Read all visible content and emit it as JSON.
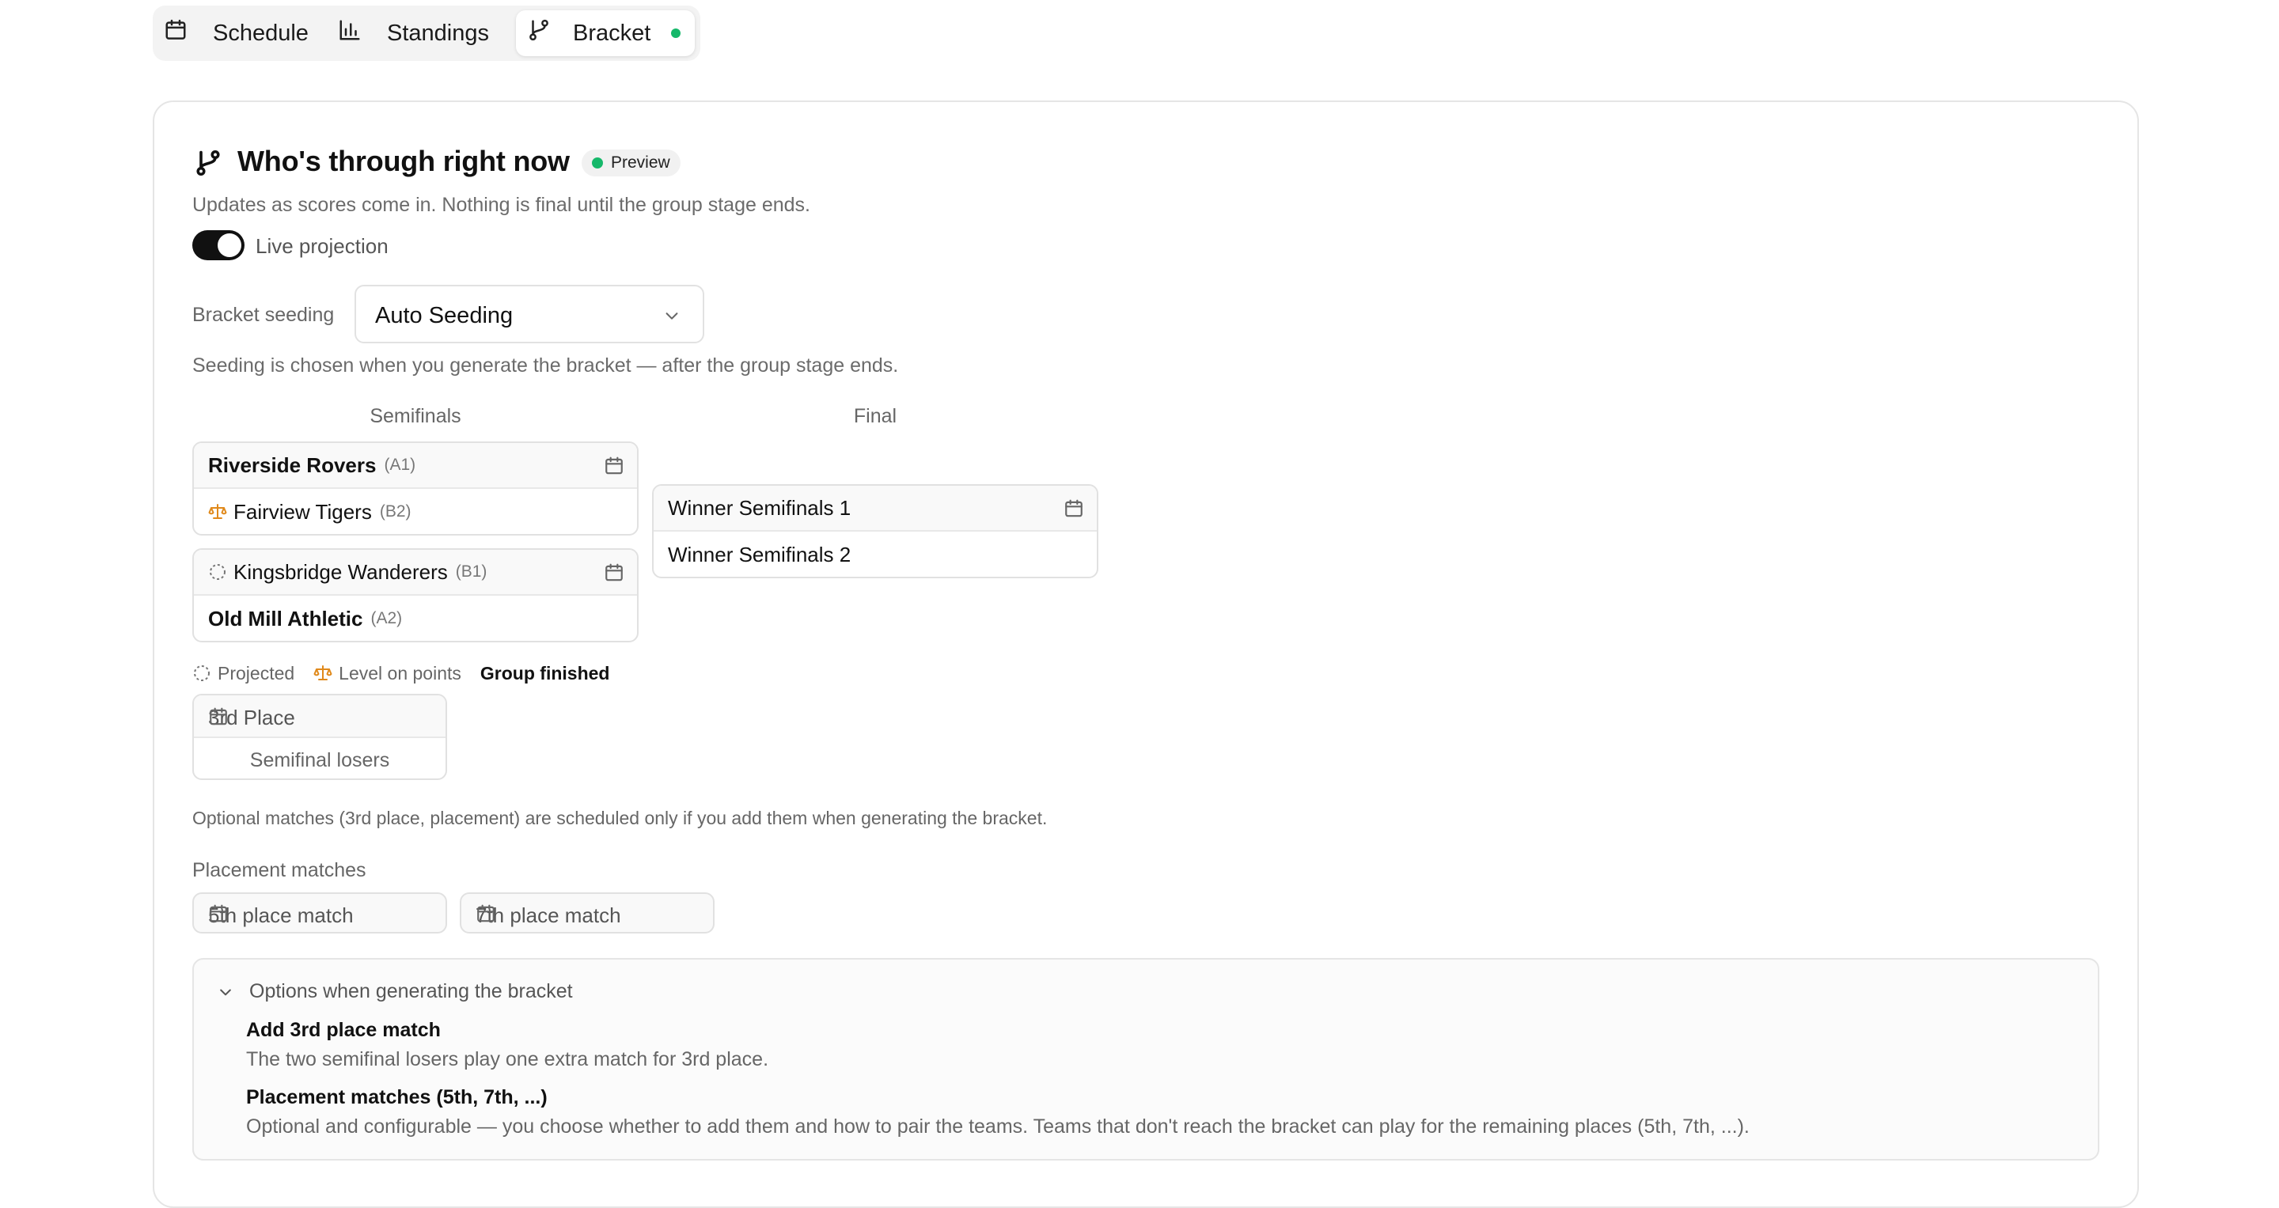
{
  "tabs": [
    {
      "label": "Schedule",
      "icon": "calendar-icon",
      "active": false
    },
    {
      "label": "Standings",
      "icon": "bar-chart-icon",
      "active": false
    },
    {
      "label": "Bracket",
      "icon": "git-branch-icon",
      "active": true
    }
  ],
  "header": {
    "title": "Who's through right now",
    "badge": "Preview",
    "subtitle": "Updates as scores come in. Nothing is final until the group stage ends."
  },
  "projection": {
    "label": "Live projection",
    "enabled": true
  },
  "seeding": {
    "label": "Bracket seeding",
    "value": "Auto Seeding",
    "note": "Seeding is chosen when you generate the bracket — after the group stage ends."
  },
  "bracket": {
    "rounds": [
      "Semifinals",
      "Final"
    ],
    "semifinals": [
      {
        "home": {
          "name": "Riverside Rovers",
          "seed": "(A1)",
          "status": "finished"
        },
        "away": {
          "name": "Fairview Tigers",
          "seed": "(B2)",
          "status": "level"
        }
      },
      {
        "home": {
          "name": "Kingsbridge Wanderers",
          "seed": "(B1)",
          "status": "projected"
        },
        "away": {
          "name": "Old Mill Athletic",
          "seed": "(A2)",
          "status": "finished"
        }
      }
    ],
    "final": {
      "home": "Winner Semifinals 1",
      "away": "Winner Semifinals 2"
    }
  },
  "legend": {
    "projected": "Projected",
    "level": "Level on points",
    "finished": "Group finished"
  },
  "third_place": {
    "title": "3rd Place",
    "subtitle": "Semifinal losers"
  },
  "optional_note": "Optional matches (3rd place, placement) are scheduled only if you add them when generating the bracket.",
  "placement": {
    "label": "Placement matches",
    "matches": [
      "5th place match",
      "7th place match"
    ]
  },
  "options": {
    "heading": "Options when generating the bracket",
    "items": [
      {
        "title": "Add 3rd place match",
        "desc": "The two semifinal losers play one extra match for 3rd place."
      },
      {
        "title": "Placement matches (5th, 7th, ...)",
        "desc": "Optional and configurable — you choose whether to add them and how to pair the teams. Teams that don't reach the bracket can play for the remaining places (5th, 7th, ...)."
      }
    ]
  },
  "colors": {
    "accent_green": "#16b86a",
    "level_orange": "#e0891b",
    "toggle_on": "#111111"
  }
}
